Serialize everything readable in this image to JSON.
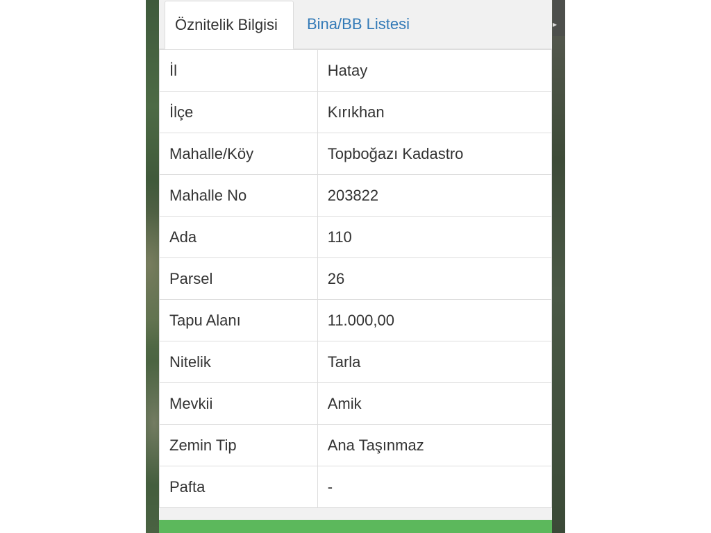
{
  "tabs": [
    {
      "label": "Öznitelik Bilgisi",
      "active": true
    },
    {
      "label": "Bina/BB Listesi",
      "active": false
    }
  ],
  "attributes": [
    {
      "key": "İl",
      "value": "Hatay"
    },
    {
      "key": "İlçe",
      "value": "Kırıkhan"
    },
    {
      "key": "Mahalle/Köy",
      "value": "Topboğazı Kadastro"
    },
    {
      "key": "Mahalle No",
      "value": "203822"
    },
    {
      "key": "Ada",
      "value": "110"
    },
    {
      "key": "Parsel",
      "value": "26"
    },
    {
      "key": "Tapu Alanı",
      "value": "11.000,00"
    },
    {
      "key": "Nitelik",
      "value": "Tarla"
    },
    {
      "key": "Mevkii",
      "value": "Amik"
    },
    {
      "key": "Zemin Tip",
      "value": "Ana Taşınmaz"
    },
    {
      "key": "Pafta",
      "value": "-"
    }
  ],
  "colors": {
    "link": "#337ab7",
    "action_bar": "#5cb85c",
    "border": "#dddddd"
  }
}
